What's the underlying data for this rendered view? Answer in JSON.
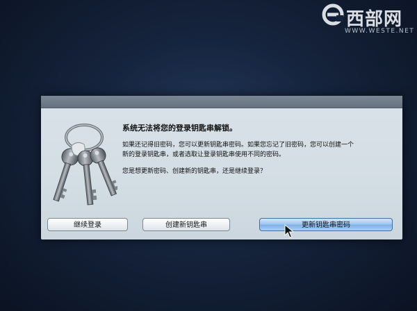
{
  "watermark": {
    "logo_text": "西部网",
    "url": "WWW.WESTE.NET"
  },
  "dialog": {
    "icon": "keys-icon",
    "title": "系统无法将您的登录钥匙串解锁。",
    "message_line1": "如果还记得旧密码，您可以更新钥匙串密码。如果您忘记了旧密码，您可以创建一个",
    "message_line2": "新的登录钥匙串，或者选取让登录钥匙串使用不同的密码。",
    "question": "您是想更新密码、创建新的钥匙串，还是继续登录？",
    "buttons": {
      "continue_label": "继续登录",
      "create_label": "创建新钥匙串",
      "update_label": "更新钥匙串密码"
    }
  },
  "colors": {
    "dialog_bg": "#d6dfe6",
    "default_button": "#8dbbeb",
    "desktop_bg": "#15233c"
  }
}
